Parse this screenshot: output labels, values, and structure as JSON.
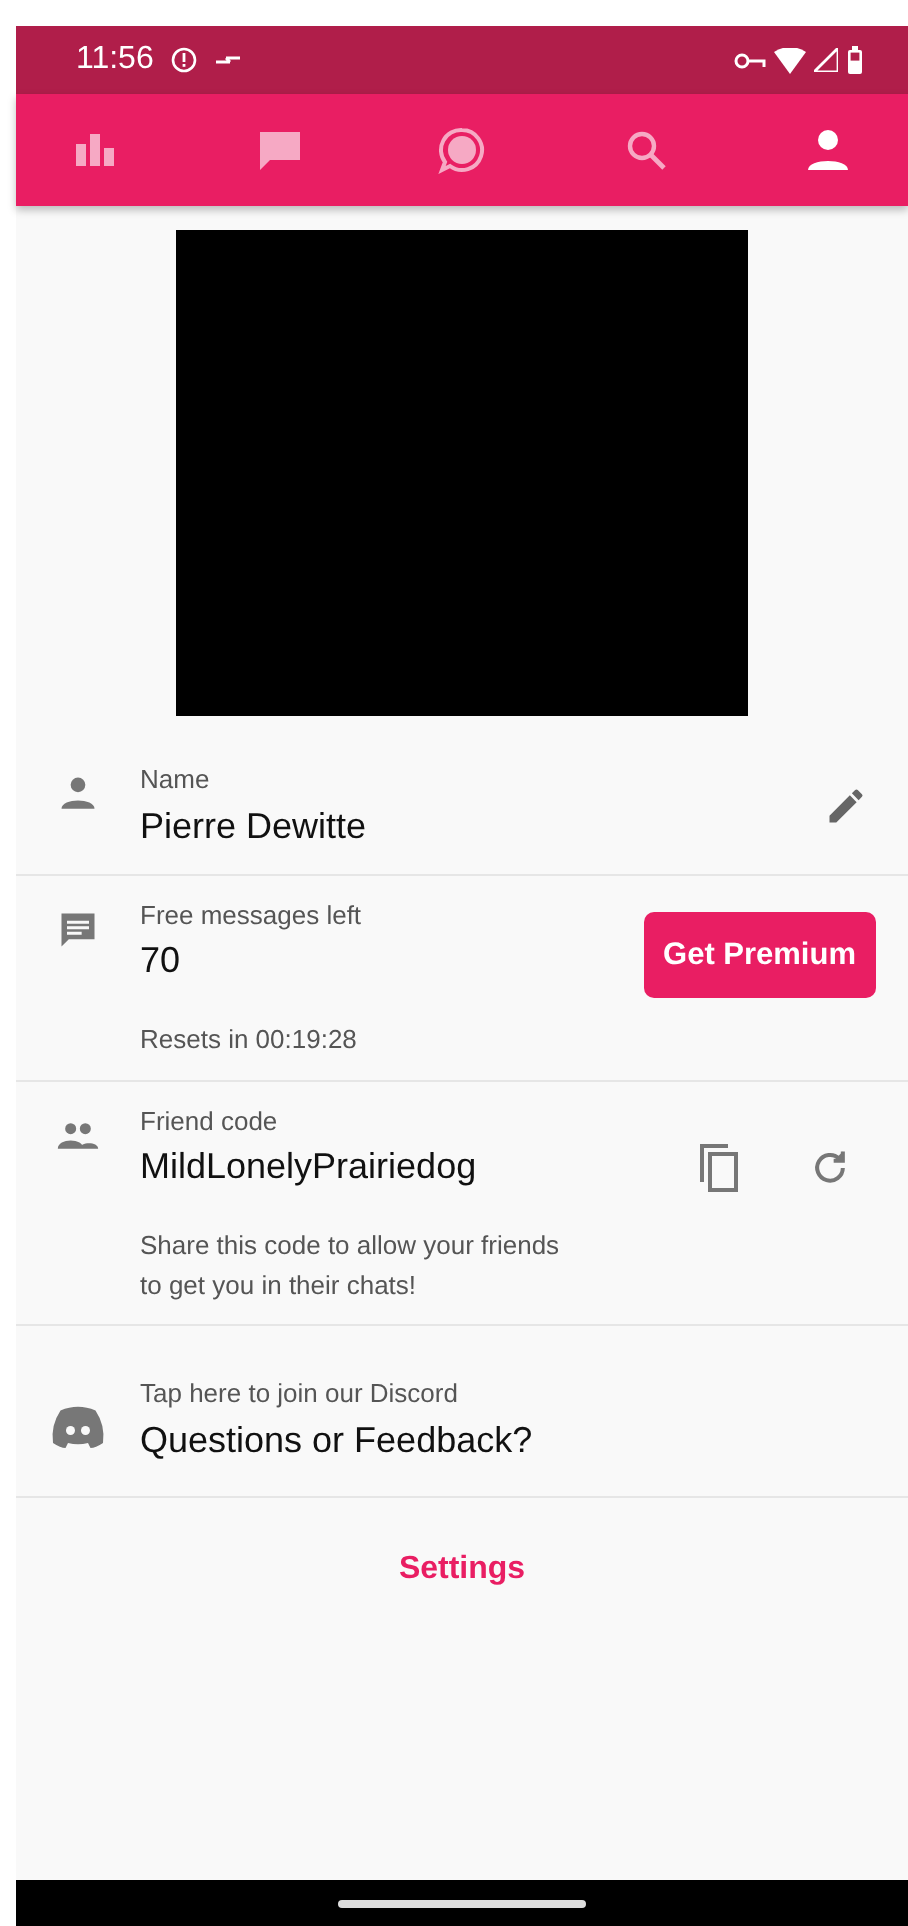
{
  "status_bar": {
    "time": "11:56"
  },
  "tabs": [
    {
      "kind": "stats",
      "selected": false
    },
    {
      "kind": "chat",
      "selected": false
    },
    {
      "kind": "bubble",
      "selected": false
    },
    {
      "kind": "search",
      "selected": false
    },
    {
      "kind": "profile",
      "selected": true
    }
  ],
  "rows": [
    {
      "kind": "name",
      "label": "Name",
      "value": "Pierre Dewitte"
    },
    {
      "kind": "messages",
      "label": "Free messages left",
      "value": "70",
      "note": "Resets in 00:19:28",
      "button": "Get Premium"
    },
    {
      "kind": "friend",
      "label": "Friend code",
      "value": "MildLonelyPrairiedog",
      "note": "Share this code to allow your friends to get you in their chats!"
    },
    {
      "kind": "discord",
      "label": "Tap here to join our Discord",
      "value": "Questions or Feedback?"
    }
  ],
  "settings_link": "Settings"
}
